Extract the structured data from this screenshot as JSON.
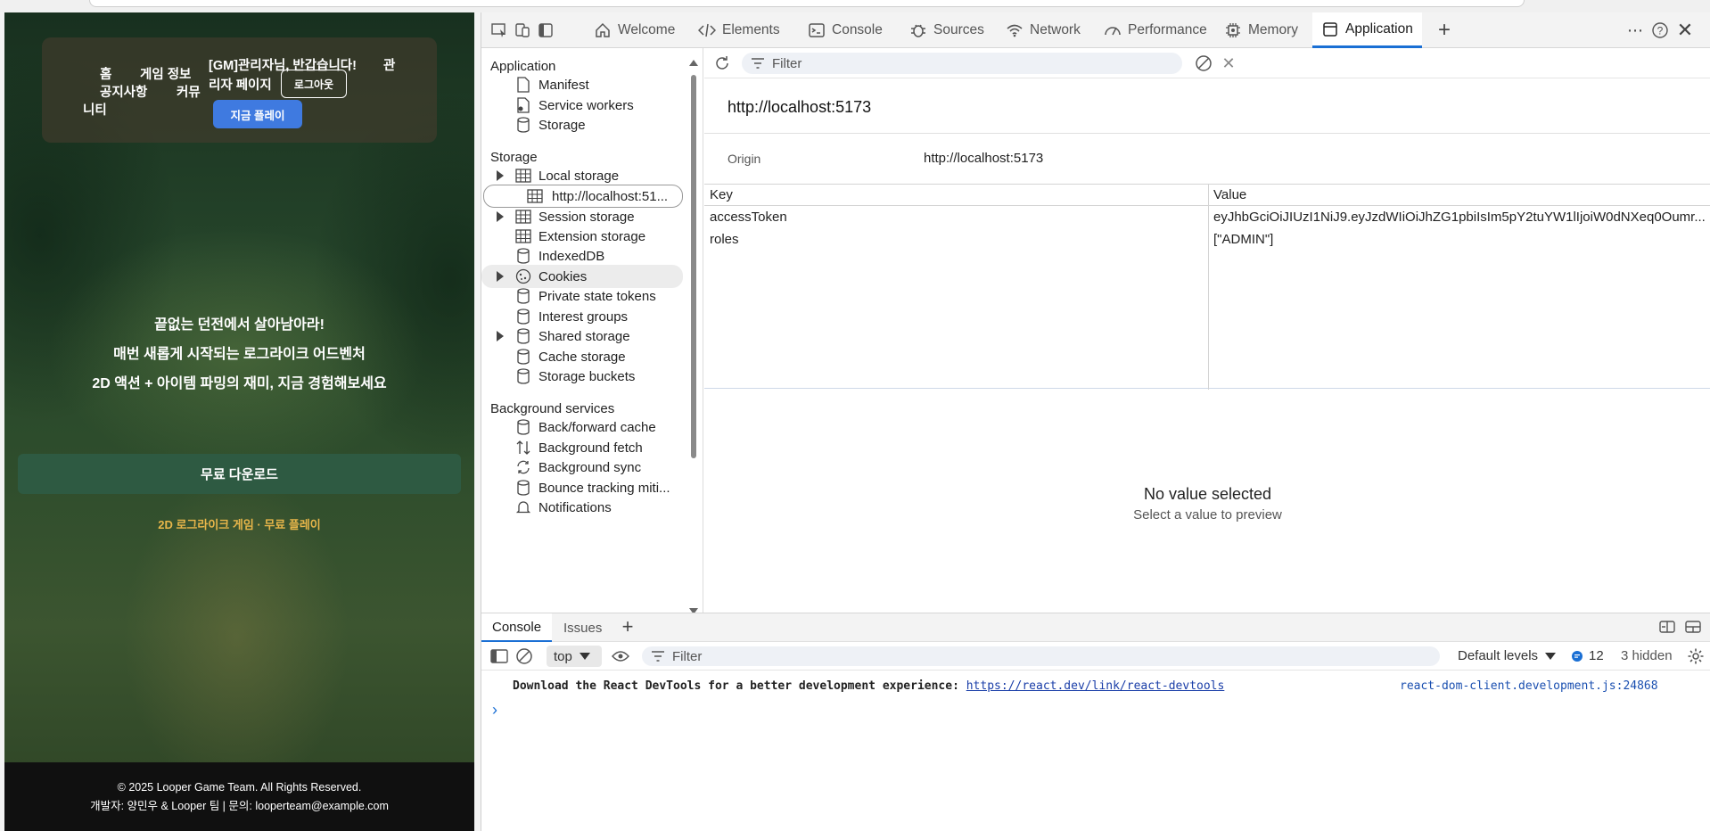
{
  "page": {
    "nav": {
      "home": "홈",
      "game_info": "게임 정보",
      "notice": "공지사항",
      "community_1": "커뮤",
      "community_2": "니티",
      "greeting": "[GM]관리자님, 반갑습니다!",
      "admin_1": "관",
      "admin_2": "리자 페이지",
      "logout": "로그아웃",
      "play_now": "지금 플레이"
    },
    "hero": {
      "line1": "끝없는 던전에서 살아남아라!",
      "line2": "매번 새롭게 시작되는 로그라이크 어드벤처",
      "line3": "2D 액션 + 아이템 파밍의 재미, 지금 경험해보세요"
    },
    "download": "무료 다운로드",
    "tagline": "2D 로그라이크 게임 · 무료 플레이",
    "footer": {
      "copyright": "© 2025 Looper Game Team. All Rights Reserved.",
      "contact": "개발자: 양민우 & Looper 팀 | 문의: looperteam@example.com"
    }
  },
  "devtools": {
    "tabs": [
      "Welcome",
      "Elements",
      "Console",
      "Sources",
      "Network",
      "Performance",
      "Memory",
      "Application"
    ],
    "active_tab": "Application",
    "sidebar": {
      "application_header": "Application",
      "application_items": [
        "Manifest",
        "Service workers",
        "Storage"
      ],
      "storage_header": "Storage",
      "storage_items": [
        "Local storage",
        "http://localhost:51...",
        "Session storage",
        "Extension storage",
        "IndexedDB",
        "Cookies",
        "Private state tokens",
        "Interest groups",
        "Shared storage",
        "Cache storage",
        "Storage buckets"
      ],
      "background_header": "Background services",
      "background_items": [
        "Back/forward cache",
        "Background fetch",
        "Background sync",
        "Bounce tracking miti...",
        "Notifications"
      ]
    },
    "main": {
      "filter_placeholder": "Filter",
      "origin_title": "http://localhost:5173",
      "origin_label": "Origin",
      "origin_value": "http://localhost:5173",
      "col_key": "Key",
      "col_value": "Value",
      "rows": [
        {
          "key": "accessToken",
          "value": "eyJhbGciOiJIUzI1NiJ9.eyJzdWIiOiJhZG1pbiIsIm5pY2tuYW1lIjoiW0dNXeq0Oumr..."
        },
        {
          "key": "roles",
          "value": "[\"ADMIN\"]"
        }
      ],
      "no_value_title": "No value selected",
      "no_value_sub": "Select a value to preview"
    },
    "drawer": {
      "tabs": [
        "Console",
        "Issues"
      ],
      "context": "top",
      "filter_placeholder": "Filter",
      "levels": "Default levels",
      "issues_count": "12",
      "hidden": "3 hidden",
      "message": "Download the React DevTools for a better development experience: ",
      "message_link": "https://react.dev/link/react-devtools",
      "message_source": "react-dom-client.development.js:24868",
      "prompt": "›"
    }
  }
}
